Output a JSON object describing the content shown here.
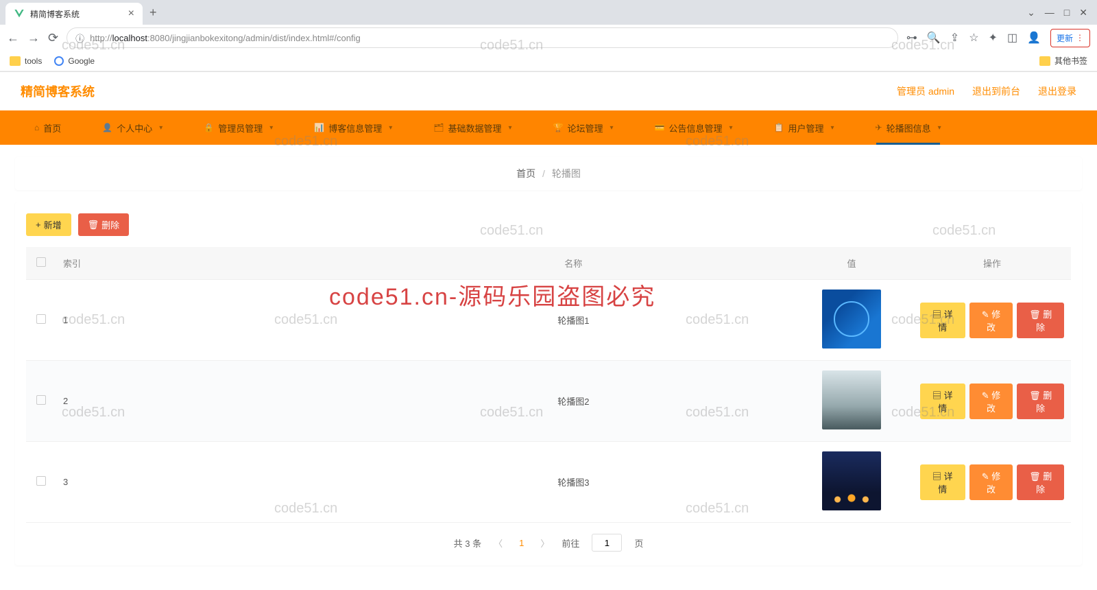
{
  "browser": {
    "tab_title": "精简博客系统",
    "url_proto": "http://",
    "url_host": "localhost",
    "url_path": ":8080/jingjianbokexitong/admin/dist/index.html#/config",
    "update_label": "更新",
    "bookmarks": {
      "tools": "tools",
      "google": "Google",
      "other": "其他书签"
    }
  },
  "header": {
    "brand": "精简博客系统",
    "admin": "管理员 admin",
    "to_front": "退出到前台",
    "logout": "退出登录"
  },
  "menu": [
    {
      "label": "首页",
      "icon": "⌂",
      "dropdown": false
    },
    {
      "label": "个人中心",
      "icon": "👤",
      "dropdown": true
    },
    {
      "label": "管理员管理",
      "icon": "🔒",
      "dropdown": true
    },
    {
      "label": "博客信息管理",
      "icon": "📊",
      "dropdown": true
    },
    {
      "label": "基础数据管理",
      "icon": "🗂",
      "dropdown": true
    },
    {
      "label": "论坛管理",
      "icon": "🏆",
      "dropdown": true
    },
    {
      "label": "公告信息管理",
      "icon": "💳",
      "dropdown": true
    },
    {
      "label": "用户管理",
      "icon": "📋",
      "dropdown": true
    },
    {
      "label": "轮播图信息",
      "icon": "✈",
      "dropdown": true,
      "active": true
    }
  ],
  "breadcrumb": {
    "home": "首页",
    "current": "轮播图"
  },
  "toolbar": {
    "add": "新增",
    "del": "删除"
  },
  "columns": {
    "index": "索引",
    "name": "名称",
    "value": "值",
    "ops": "操作"
  },
  "rows": [
    {
      "index": "1",
      "name": "轮播图1"
    },
    {
      "index": "2",
      "name": "轮播图2"
    },
    {
      "index": "3",
      "name": "轮播图3"
    }
  ],
  "ops": {
    "detail": "详情",
    "edit": "修改",
    "delete": "删除"
  },
  "pagination": {
    "total": "共 3 条",
    "page": "1",
    "goto_pre": "前往",
    "goto_val": "1",
    "goto_suf": "页"
  },
  "watermark": {
    "small": "code51.cn",
    "big": "code51.cn-源码乐园盗图必究"
  }
}
